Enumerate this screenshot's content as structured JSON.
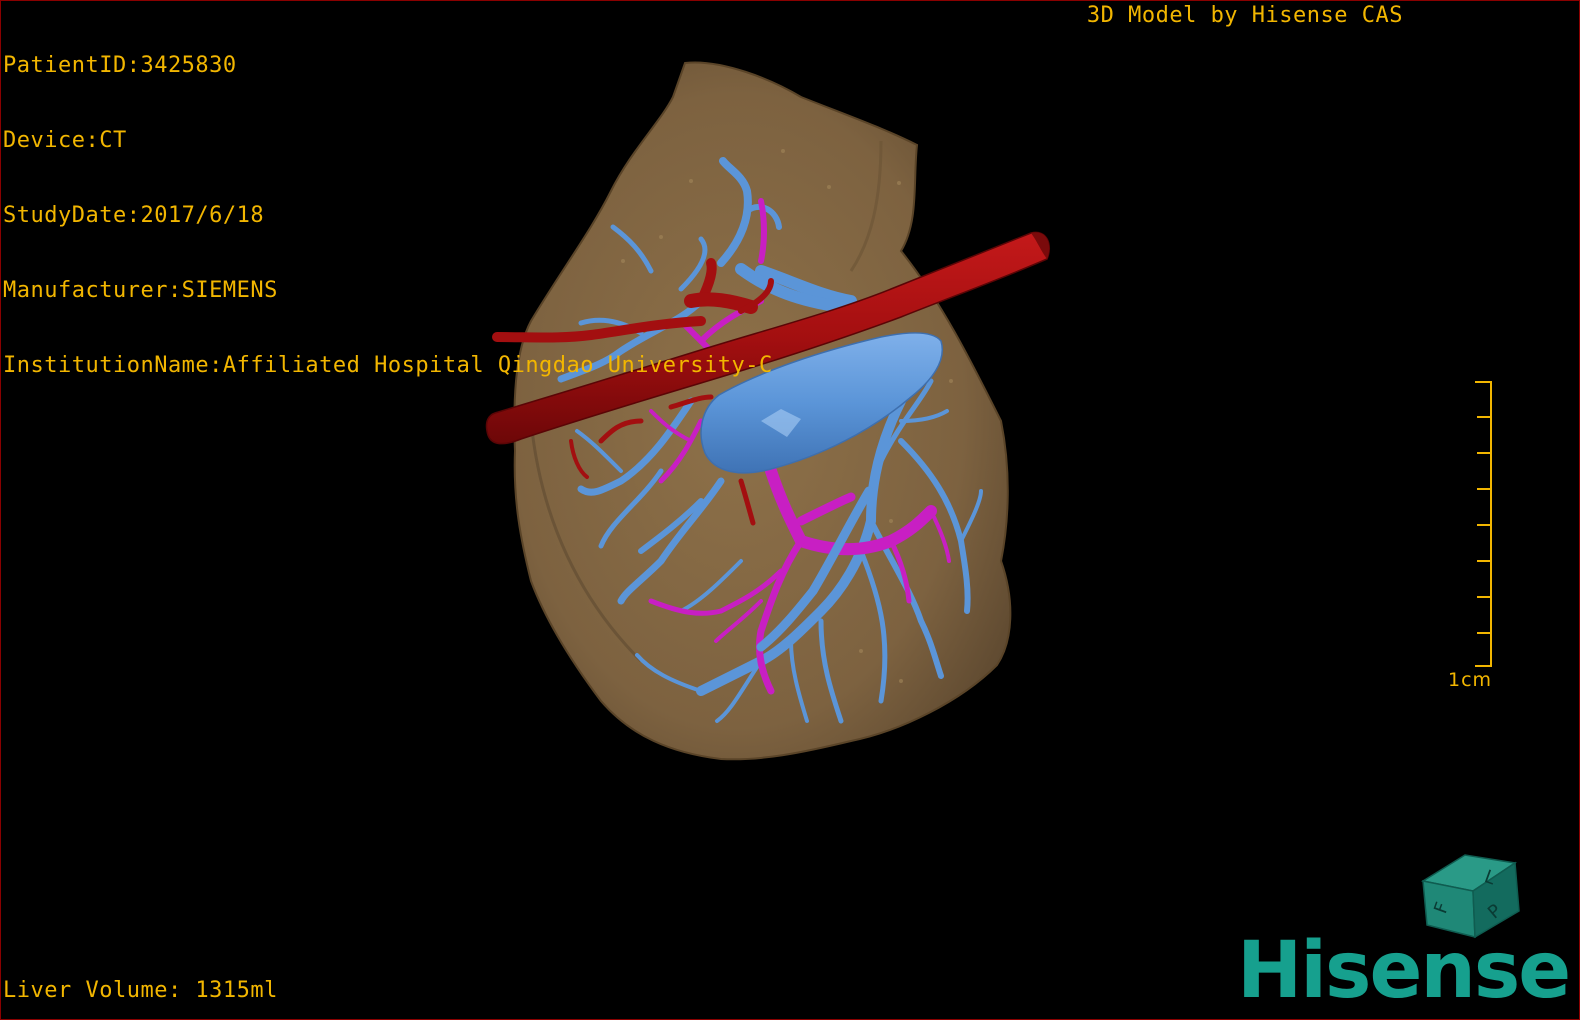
{
  "dicom_info": {
    "lines": [
      "PatientID:3425830",
      "Device:CT",
      "StudyDate:2017/6/18",
      "Manufacturer:SIEMENS",
      "InstitutionName:Affiliated Hospital Qingdao University-C"
    ]
  },
  "credit": "3D Model by Hisense CAS",
  "volume_label": "Liver Volume: 1315ml",
  "scale": {
    "label": "1cm"
  },
  "orientation_cube": {
    "faces": [
      "F",
      "L",
      "P"
    ]
  },
  "brand": "Hisense",
  "colors": {
    "overlay_text": "#f2b600",
    "liver": "#7f6540",
    "artery": "#a30f10",
    "hepatic_vein": "#5b95d8",
    "portal_vein": "#c81fc3",
    "brand": "#16a08e",
    "frame": "#8a0000"
  },
  "icons": [
    "orientation-cube-icon",
    "hisense-logo",
    "scale-bar-icon"
  ]
}
